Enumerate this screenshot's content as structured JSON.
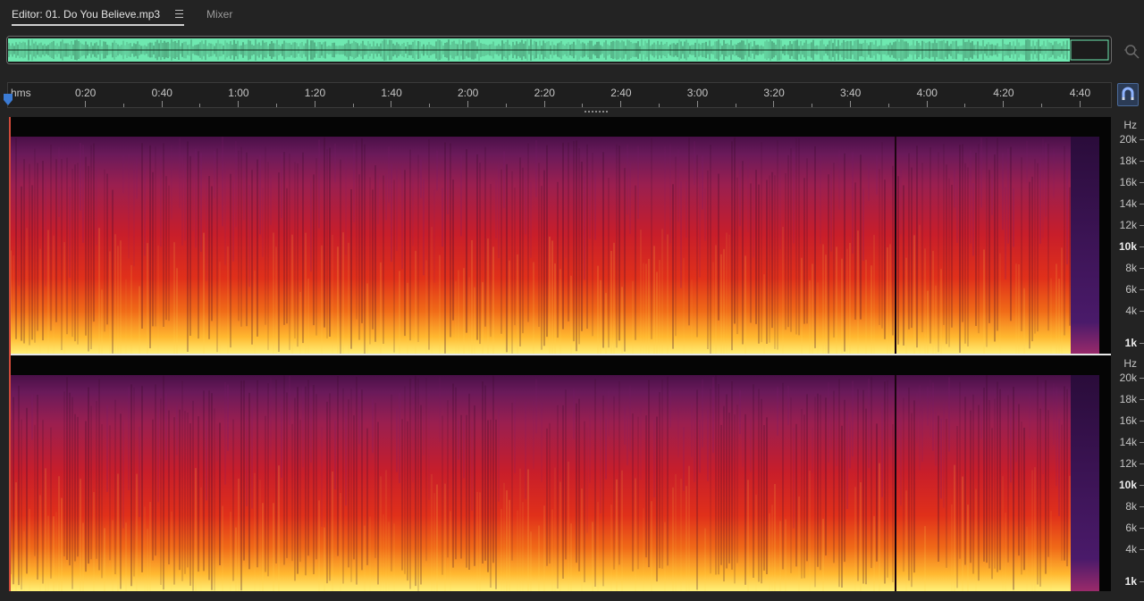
{
  "tabs": {
    "editor_label": "Editor: 01. Do You Believe.mp3",
    "mixer_label": "Mixer"
  },
  "timeline": {
    "unit_label": "hms",
    "ticks": [
      "0:20",
      "0:40",
      "1:00",
      "1:20",
      "1:40",
      "2:00",
      "2:20",
      "2:40",
      "3:00",
      "3:20",
      "3:40",
      "4:00",
      "4:20",
      "4:40"
    ]
  },
  "frequency_scale": {
    "unit_label": "Hz",
    "labels": [
      "20k",
      "18k",
      "16k",
      "14k",
      "12k",
      "10k",
      "8k",
      "6k",
      "4k",
      "1k"
    ]
  },
  "colors": {
    "waveform": "#6ee8b0",
    "spectrogram_low": "#ffe25a",
    "spectrogram_mid": "#d8201a",
    "spectrogram_high": "#7a1f6a",
    "background": "#232323",
    "accent": "#3b7bd4"
  },
  "icons": [
    "menu-icon",
    "zoom-icon",
    "playhead-marker-icon",
    "snap-magnet-icon"
  ]
}
